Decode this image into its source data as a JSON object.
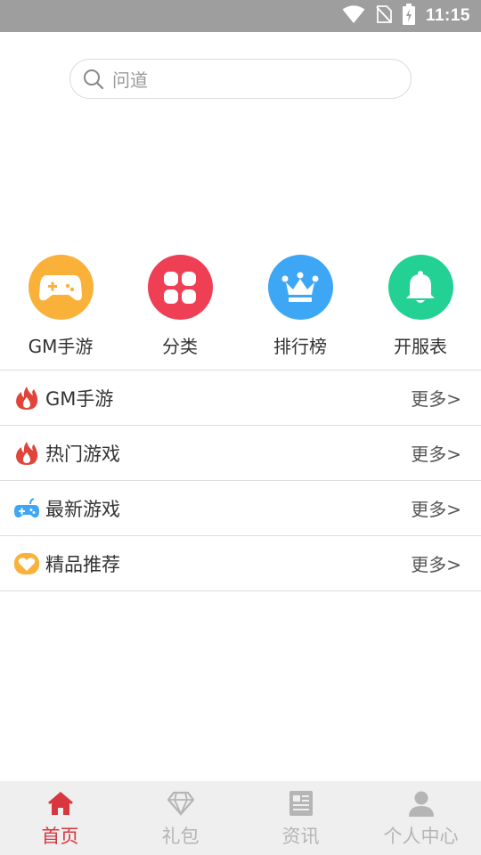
{
  "status_bar": {
    "time": "11:15"
  },
  "search": {
    "placeholder": "问道"
  },
  "quick_entries": [
    {
      "label": "GM手游",
      "icon": "gamepad-icon",
      "color": "#f9b13a"
    },
    {
      "label": "分类",
      "icon": "grid-icon",
      "color": "#ee3f55"
    },
    {
      "label": "排行榜",
      "icon": "crown-icon",
      "color": "#3ea7f5"
    },
    {
      "label": "开服表",
      "icon": "bell-icon",
      "color": "#22d193"
    }
  ],
  "sections": [
    {
      "title": "GM手游",
      "more": "更多>",
      "icon": "flame-icon"
    },
    {
      "title": "热门游戏",
      "more": "更多>",
      "icon": "flame-icon"
    },
    {
      "title": "最新游戏",
      "more": "更多>",
      "icon": "controller-icon"
    },
    {
      "title": "精品推荐",
      "more": "更多>",
      "icon": "heart-icon"
    }
  ],
  "bottom_nav": {
    "active_color": "#d9363e",
    "inactive_color": "#b5b5b5",
    "items": [
      {
        "label": "首页",
        "icon": "home-icon",
        "active": true
      },
      {
        "label": "礼包",
        "icon": "diamond-icon",
        "active": false
      },
      {
        "label": "资讯",
        "icon": "news-icon",
        "active": false
      },
      {
        "label": "个人中心",
        "icon": "user-icon",
        "active": false
      }
    ]
  }
}
